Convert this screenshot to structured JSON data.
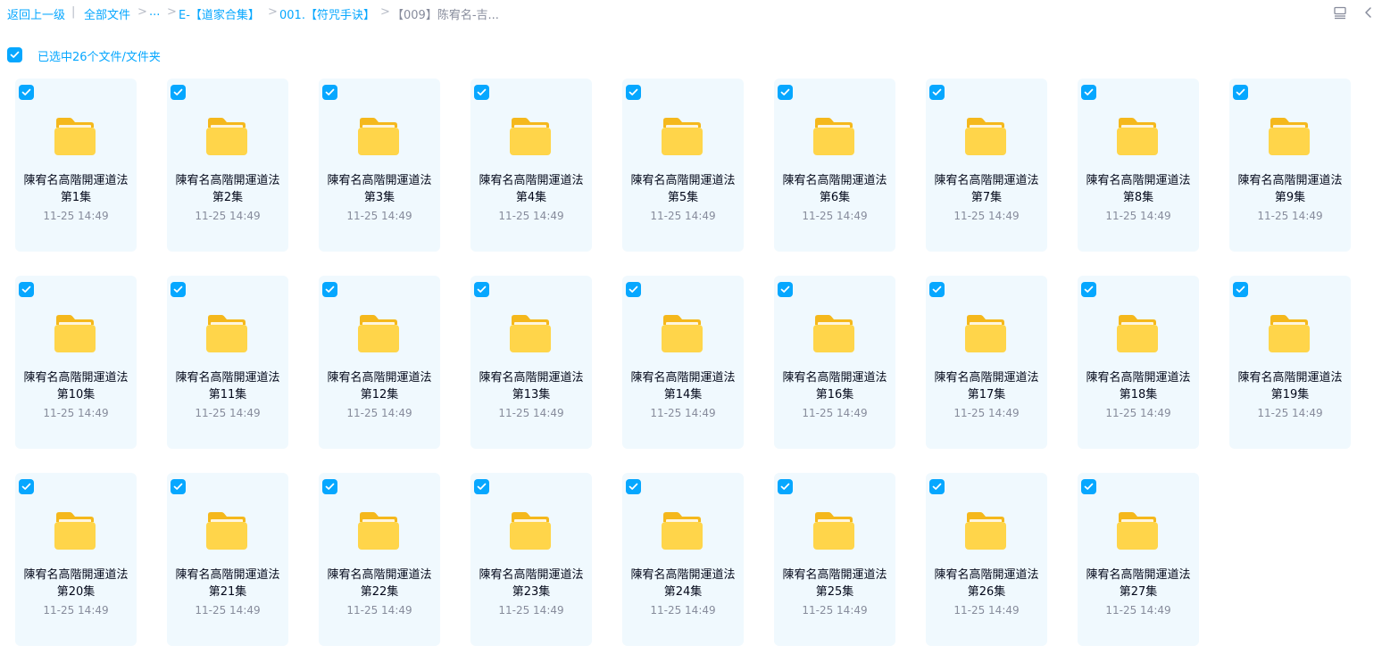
{
  "breadcrumb": {
    "back": "返回上一级",
    "sep1": "|",
    "all_files": "全部文件",
    "arrow": ">",
    "ellipsis": "...",
    "level1": "E-【道家合集】",
    "level2": "001.【符咒手诀】",
    "current": "【009】陈宥名-吉..."
  },
  "selection": {
    "label": "已选中26个文件/文件夹"
  },
  "icons": {
    "list_view": "list-view-icon",
    "collapse": "chevron-left-icon",
    "checkbox": "checkbox-checked-icon",
    "folder": "folder-icon"
  },
  "colors": {
    "accent": "#06a7ff",
    "card_bg": "#f0f9fe",
    "folder": "#ffd54a",
    "muted": "#878c9c"
  },
  "files": [
    {
      "name": "陳宥名高階開運道法第1集",
      "date": "11-25 14:49"
    },
    {
      "name": "陳宥名高階開運道法第2集",
      "date": "11-25 14:49"
    },
    {
      "name": "陳宥名高階開運道法第3集",
      "date": "11-25 14:49"
    },
    {
      "name": "陳宥名高階開運道法第4集",
      "date": "11-25 14:49"
    },
    {
      "name": "陳宥名高階開運道法第5集",
      "date": "11-25 14:49"
    },
    {
      "name": "陳宥名高階開運道法第6集",
      "date": "11-25 14:49"
    },
    {
      "name": "陳宥名高階開運道法第7集",
      "date": "11-25 14:49"
    },
    {
      "name": "陳宥名高階開運道法第8集",
      "date": "11-25 14:49"
    },
    {
      "name": "陳宥名高階開運道法第9集",
      "date": "11-25 14:49"
    },
    {
      "name": "陳宥名高階開運道法第10集",
      "date": "11-25 14:49"
    },
    {
      "name": "陳宥名高階開運道法第11集",
      "date": "11-25 14:49"
    },
    {
      "name": "陳宥名高階開運道法第12集",
      "date": "11-25 14:49"
    },
    {
      "name": "陳宥名高階開運道法第13集",
      "date": "11-25 14:49"
    },
    {
      "name": "陳宥名高階開運道法第14集",
      "date": "11-25 14:49"
    },
    {
      "name": "陳宥名高階開運道法第16集",
      "date": "11-25 14:49"
    },
    {
      "name": "陳宥名高階開運道法第17集",
      "date": "11-25 14:49"
    },
    {
      "name": "陳宥名高階開運道法第18集",
      "date": "11-25 14:49"
    },
    {
      "name": "陳宥名高階開運道法第19集",
      "date": "11-25 14:49"
    },
    {
      "name": "陳宥名高階開運道法第20集",
      "date": "11-25 14:49"
    },
    {
      "name": "陳宥名高階開運道法第21集",
      "date": "11-25 14:49"
    },
    {
      "name": "陳宥名高階開運道法第22集",
      "date": "11-25 14:49"
    },
    {
      "name": "陳宥名高階開運道法第23集",
      "date": "11-25 14:49"
    },
    {
      "name": "陳宥名高階開運道法第24集",
      "date": "11-25 14:49"
    },
    {
      "name": "陳宥名高階開運道法第25集",
      "date": "11-25 14:49"
    },
    {
      "name": "陳宥名高階開運道法第26集",
      "date": "11-25 14:49"
    },
    {
      "name": "陳宥名高階開運道法第27集",
      "date": "11-25 14:49"
    }
  ]
}
